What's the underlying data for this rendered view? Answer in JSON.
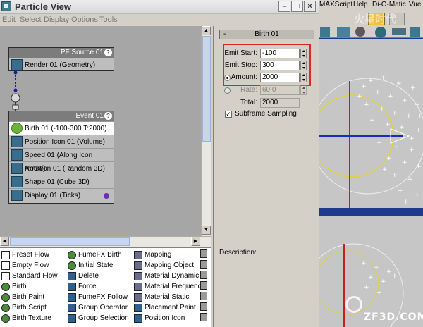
{
  "window": {
    "title": "Particle View"
  },
  "menu": [
    "Edit",
    "Select",
    "Display",
    "Options",
    "Tools"
  ],
  "source_node": {
    "title": "PF Source 01",
    "operators": [
      "Render 01 (Geometry)"
    ]
  },
  "event_node": {
    "title": "Event 01",
    "operators": [
      "Birth 01 (-100-300 T:2000)",
      "Position Icon 01 (Volume)",
      "Speed 01 (Along Icon Arrow)",
      "Rotation 01 (Random 3D)",
      "Shape 01 (Cube 3D)",
      "Display 01 (Ticks)"
    ]
  },
  "params": {
    "rollout_toggle": "-",
    "rollout_title": "Birth 01",
    "emit_start_label": "Emit Start:",
    "emit_start_value": "-100",
    "emit_stop_label": "Emit Stop:",
    "emit_stop_value": "300",
    "amount_label": "Amount:",
    "amount_value": "2000",
    "rate_label": "Rate:",
    "rate_value": "60.0",
    "total_label": "Total:",
    "total_value": "2000",
    "subframe_label": "Subframe Sampling",
    "subframe_checked": true,
    "highlight_color": "#d8262c"
  },
  "description": {
    "label": "Description:"
  },
  "depot": {
    "col1": [
      "Preset Flow",
      "Empty Flow",
      "Standard Flow",
      "Birth",
      "Birth Paint",
      "Birth Script",
      "Birth Texture"
    ],
    "col2": [
      "FumeFX Birth",
      "Initial State",
      "Delete",
      "Force",
      "FumeFX Follow",
      "Group Operator",
      "Group Selection"
    ],
    "col3": [
      "Mapping",
      "Mapping Object",
      "Material Dynamic",
      "Material Frequency",
      "Material Static",
      "Placement Paint",
      "Position Icon"
    ]
  },
  "main_menu": [
    "MAXScript",
    "Help",
    "Di-O-Matic",
    "Vue"
  ],
  "watermark": {
    "line1": "火星时代",
    "line2": "ZF3D.COM"
  }
}
